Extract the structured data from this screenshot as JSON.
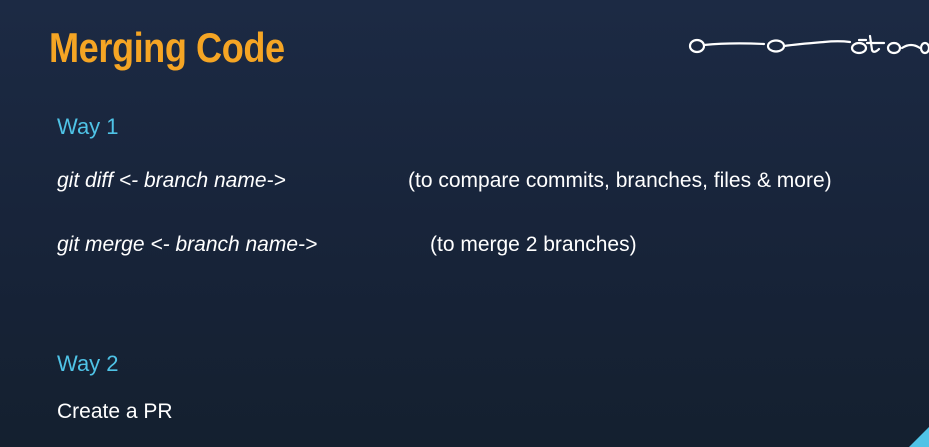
{
  "slide": {
    "title": "Merging Code",
    "way1": {
      "label": "Way 1",
      "commands": [
        {
          "command": "git diff <- branch name->",
          "description": "(to compare commits, branches, files & more)"
        },
        {
          "command": "git merge <- branch name->",
          "description": "(to merge 2 branches)"
        }
      ]
    },
    "way2": {
      "label": "Way 2",
      "text": "Create a PR"
    }
  },
  "colors": {
    "background": "#1a2740",
    "title": "#f5a524",
    "accent": "#4fc3e6",
    "text": "#ffffff"
  },
  "icons": {
    "doodle": "commit-graph-sketch-icon",
    "corner": "corner-accent"
  }
}
